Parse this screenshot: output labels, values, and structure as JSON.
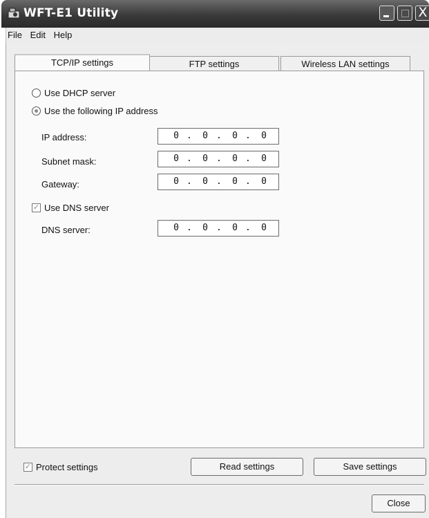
{
  "window": {
    "title": "WFT-E1 Utility",
    "close_glyph": "X"
  },
  "menu": [
    "File",
    "Edit",
    "Help"
  ],
  "tabs": [
    "TCP/IP settings",
    "FTP settings",
    "Wireless LAN settings"
  ],
  "tcpip": {
    "dhcp_label": "Use DHCP server",
    "static_label": "Use the following IP address",
    "ip_label": "IP address:",
    "subnet_label": "Subnet mask:",
    "gateway_label": "Gateway:",
    "dns_check_label": "Use DNS server",
    "dns_label": "DNS server:",
    "ip": [
      "0",
      "0",
      "0",
      "0"
    ],
    "subnet": [
      "0",
      "0",
      "0",
      "0"
    ],
    "gateway": [
      "0",
      "0",
      "0",
      "0"
    ],
    "dns": [
      "0",
      "0",
      "0",
      "0"
    ],
    "dot": "."
  },
  "footer": {
    "protect_label": "Protect settings",
    "read_label": "Read settings",
    "save_label": "Save settings",
    "close_label": "Close",
    "check_glyph": "✓"
  }
}
